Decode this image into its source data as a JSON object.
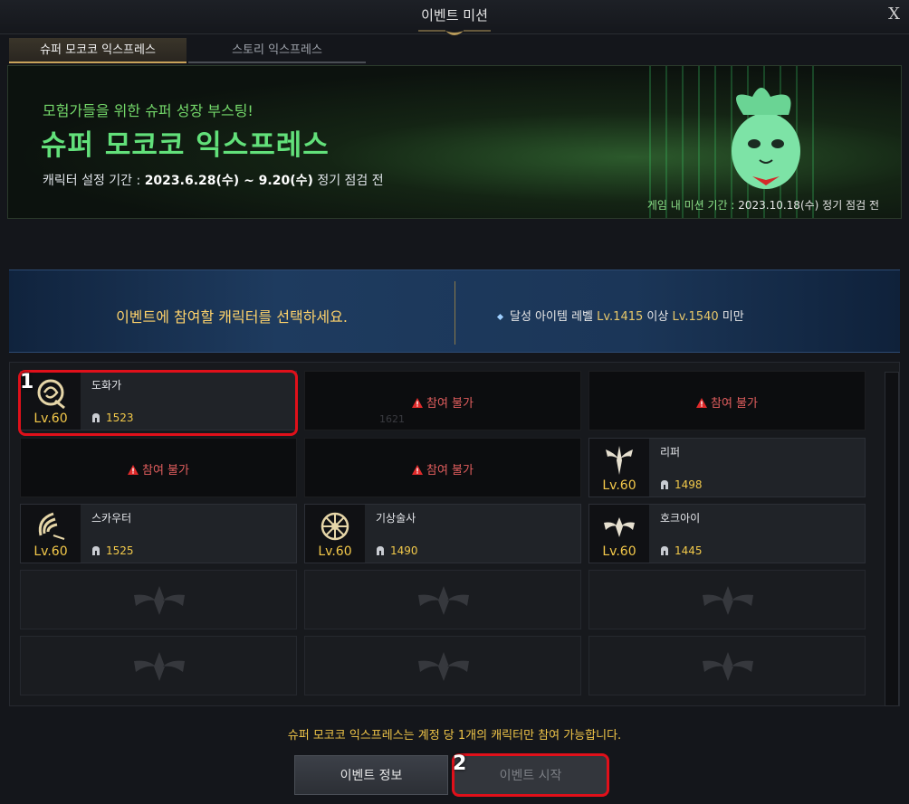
{
  "window": {
    "title": "이벤트 미션",
    "close_label": "X"
  },
  "tabs": [
    {
      "label": "슈퍼 모코코 익스프레스",
      "active": true
    },
    {
      "label": "스토리 익스프레스",
      "active": false
    }
  ],
  "banner": {
    "subtitle": "모험가들을 위한 슈퍼 성장 부스팅!",
    "title": "슈퍼 모코코 익스프레스",
    "setup_label": "캐릭터 설정 기간 : ",
    "setup_dates": "2023.6.28(수) ~ 9.20(수)",
    "setup_suffix": " 정기 점검 전",
    "mission_label": "게임 내 미션 기간 : ",
    "mission_value": "2023.10.18(수) 정기 점검 전"
  },
  "selection": {
    "message": "이벤트에 참여할 캐릭터를 선택하세요.",
    "req_prefix": "달성 아이템 레벨 ",
    "req_min": "Lv.1415",
    "req_mid": " 이상 ",
    "req_max": "Lv.1540",
    "req_suffix": " 미만"
  },
  "characters": [
    {
      "name": "도화가",
      "level": "Lv.60",
      "item_level": "1523",
      "icon": "artist-class-icon",
      "status": "available"
    },
    {
      "status": "locked",
      "warn": "참여 불가",
      "ghost_item_level": "1621"
    },
    {
      "status": "locked",
      "warn": "참여 불가"
    },
    {
      "status": "locked",
      "warn": "참여 불가"
    },
    {
      "status": "locked",
      "warn": "참여 불가"
    },
    {
      "name": "리퍼",
      "level": "Lv.60",
      "item_level": "1498",
      "icon": "reaper-class-icon",
      "status": "available"
    },
    {
      "name": "스카우터",
      "level": "Lv.60",
      "item_level": "1525",
      "icon": "scouter-class-icon",
      "status": "available"
    },
    {
      "name": "기상술사",
      "level": "Lv.60",
      "item_level": "1490",
      "icon": "aeromancer-class-icon",
      "status": "available"
    },
    {
      "name": "호크아이",
      "level": "Lv.60",
      "item_level": "1445",
      "icon": "hawkeye-class-icon",
      "status": "available"
    }
  ],
  "annotations": {
    "one": "1",
    "two": "2"
  },
  "footer": {
    "notice": "슈퍼 모코코 익스프레스는 계정 당 1개의 캐릭터만 참여 가능합니다.",
    "info_button": "이벤트 정보",
    "start_button": "이벤트 시작"
  },
  "colors": {
    "accent_gold": "#f2c94a",
    "highlight_red": "#e0101a",
    "banner_green": "#62e07a",
    "warn_red": "#e25e5e"
  }
}
